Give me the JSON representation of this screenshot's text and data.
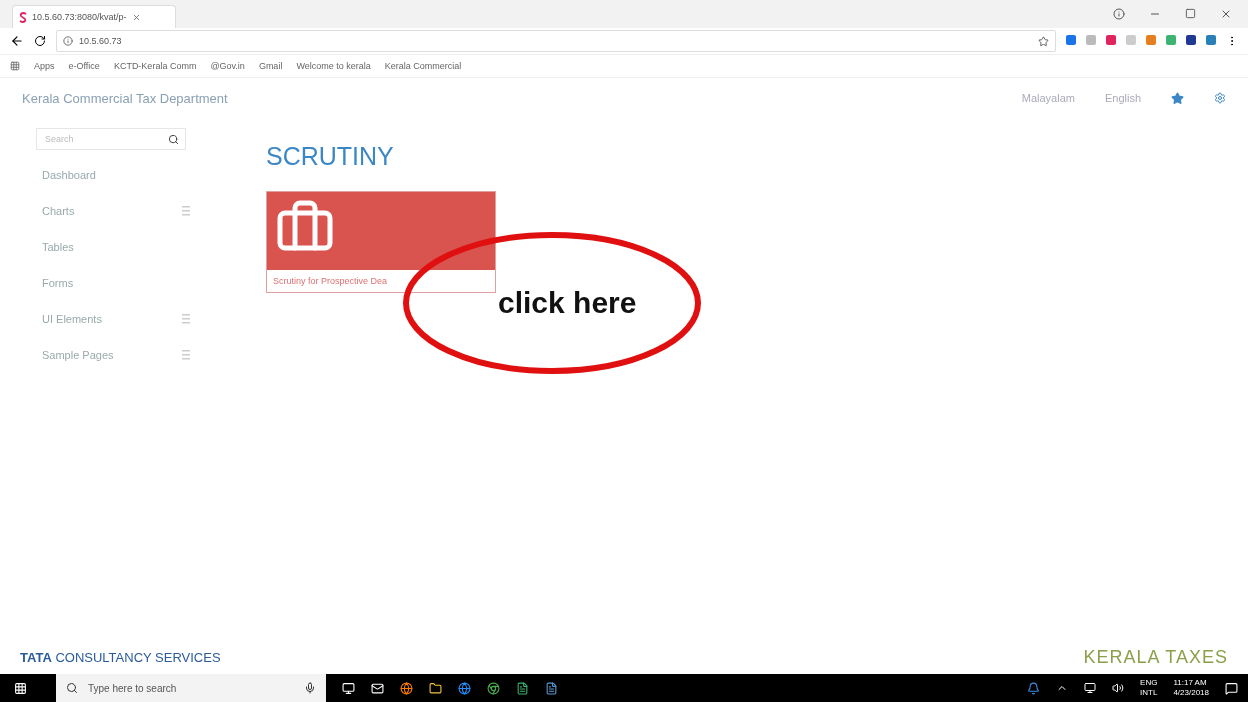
{
  "browser": {
    "tab_title": "10.5.60.73:8080/kvat/p-",
    "url": "10.5.60.73",
    "bookmarks": [
      "Apps",
      "e-Office",
      "KCTD-Kerala Comm",
      "@Gov.in",
      "Gmail",
      "Welcome to kerala",
      "Kerala Commercial"
    ]
  },
  "header": {
    "title": "Kerala Commercial Tax Department",
    "links": [
      "Malayalam",
      "English"
    ]
  },
  "sidebar": {
    "search": {
      "placeholder": "Search"
    },
    "items": [
      {
        "label": "Dashboard",
        "expandable": false
      },
      {
        "label": "Charts",
        "expandable": true
      },
      {
        "label": "Tables",
        "expandable": false
      },
      {
        "label": "Forms",
        "expandable": false
      },
      {
        "label": "UI Elements",
        "expandable": true
      },
      {
        "label": "Sample Pages",
        "expandable": true
      }
    ]
  },
  "main": {
    "heading": "SCRUTINY",
    "cards": [
      {
        "caption": "Scrutiny for Prospective Dea"
      }
    ]
  },
  "annotation": {
    "text": "click here"
  },
  "footer": {
    "company": "**TATA** CONSULTANCY SERVICES",
    "logo": "KERALA TAXES"
  },
  "taskbar": {
    "search": {
      "placeholder": "Type here to search"
    },
    "language": "ENG",
    "layout": "INTL",
    "time": "11:17 AM",
    "date": "4/23/2018"
  }
}
